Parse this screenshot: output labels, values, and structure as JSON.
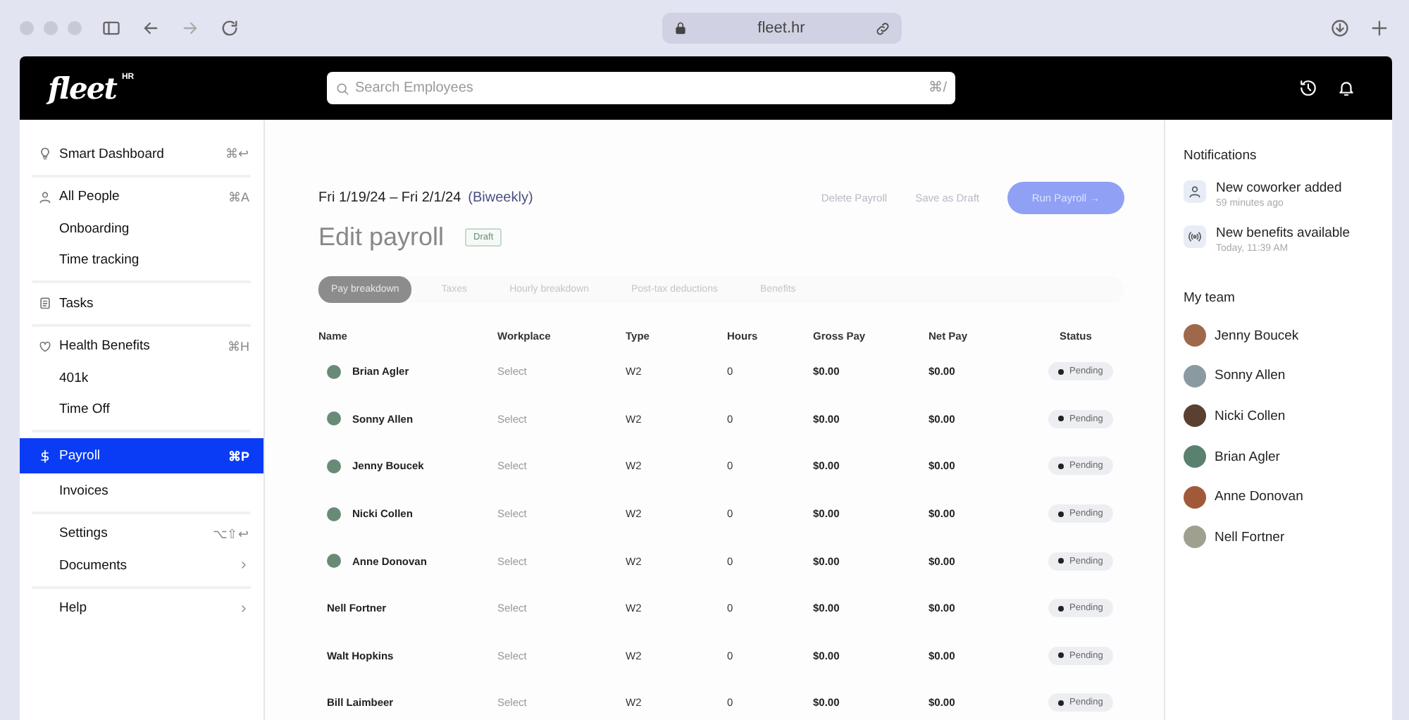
{
  "browser": {
    "address": "fleet.hr"
  },
  "header": {
    "logo": "fleet",
    "logo_badge": "HR",
    "search": {
      "placeholder": "Search Employees",
      "shortcut": "⌘/"
    }
  },
  "sidebar": {
    "groups": [
      {
        "items": [
          {
            "label": "Smart Dashboard",
            "shortcut": "⌘↩",
            "selected": false,
            "submenu": false
          }
        ]
      },
      {
        "items": [
          {
            "label": "All People",
            "shortcut": "⌘A",
            "selected": false,
            "submenu": false
          },
          {
            "label": "Onboarding",
            "selected": false,
            "submenu": false
          },
          {
            "label": "Time tracking",
            "selected": false,
            "submenu": false
          }
        ]
      },
      {
        "items": [
          {
            "label": "Tasks",
            "selected": false,
            "submenu": false
          }
        ]
      },
      {
        "items": [
          {
            "label": "Health Benefits",
            "shortcut": "⌘H",
            "selected": false,
            "submenu": false
          },
          {
            "label": "401k",
            "selected": false,
            "submenu": false
          },
          {
            "label": "Time Off",
            "selected": false,
            "submenu": false
          }
        ]
      },
      {
        "items": [
          {
            "label": "Payroll",
            "shortcut": "⌘P",
            "selected": true,
            "submenu": false
          },
          {
            "label": "Invoices",
            "selected": false,
            "submenu": false
          }
        ]
      },
      {
        "items": [
          {
            "label": "Settings",
            "shortcut": "⌥⇧↩",
            "selected": false,
            "submenu": false
          },
          {
            "label": "Documents",
            "selected": false,
            "submenu": true
          }
        ]
      },
      {
        "items": [
          {
            "label": "Help",
            "selected": false,
            "submenu": true
          }
        ]
      }
    ]
  },
  "main": {
    "period": "Fri 1/19/24 – Fri 2/1/24",
    "frequency": "(Biweekly)",
    "title": "Edit payroll",
    "badge": "Draft",
    "buttons": [
      {
        "label": "Delete Payroll",
        "kind": "text",
        "disabled": true
      },
      {
        "label": "Save as Draft",
        "kind": "text",
        "disabled": true
      },
      {
        "label": "Run Payroll →",
        "kind": "primary",
        "disabled": true
      }
    ],
    "tabs": [
      {
        "label": "Pay breakdown",
        "selected": true
      },
      {
        "label": "Taxes",
        "selected": false
      },
      {
        "label": "Hourly breakdown",
        "selected": false
      },
      {
        "label": "Post-tax deductions",
        "selected": false
      },
      {
        "label": "Benefits",
        "selected": false
      }
    ],
    "table": {
      "columns": [
        "Name",
        "Workplace",
        "Type",
        "Hours",
        "Gross Pay",
        "Net Pay",
        "Status"
      ],
      "rows": [
        {
          "name": "Brian Agler",
          "avatar": true,
          "workplace": "Select",
          "type": "W2",
          "hours": "0",
          "gross": "$0.00",
          "net": "$0.00",
          "status": "Pending"
        },
        {
          "name": "Sonny Allen",
          "avatar": true,
          "workplace": "Select",
          "type": "W2",
          "hours": "0",
          "gross": "$0.00",
          "net": "$0.00",
          "status": "Pending"
        },
        {
          "name": "Jenny Boucek",
          "avatar": true,
          "workplace": "Select",
          "type": "W2",
          "hours": "0",
          "gross": "$0.00",
          "net": "$0.00",
          "status": "Pending"
        },
        {
          "name": "Nicki Collen",
          "avatar": true,
          "workplace": "Select",
          "type": "W2",
          "hours": "0",
          "gross": "$0.00",
          "net": "$0.00",
          "status": "Pending"
        },
        {
          "name": "Anne Donovan",
          "avatar": true,
          "workplace": "Select",
          "type": "W2",
          "hours": "0",
          "gross": "$0.00",
          "net": "$0.00",
          "status": "Pending"
        },
        {
          "name": "Nell Fortner",
          "avatar": false,
          "workplace": "Select",
          "type": "W2",
          "hours": "0",
          "gross": "$0.00",
          "net": "$0.00",
          "status": "Pending"
        },
        {
          "name": "Walt Hopkins",
          "avatar": false,
          "workplace": "Select",
          "type": "W2",
          "hours": "0",
          "gross": "$0.00",
          "net": "$0.00",
          "status": "Pending"
        },
        {
          "name": "Bill Laimbeer",
          "avatar": false,
          "workplace": "Select",
          "type": "W2",
          "hours": "0",
          "gross": "$0.00",
          "net": "$0.00",
          "status": "Pending"
        }
      ]
    }
  },
  "right_panel": {
    "notifications_title": "Notifications",
    "notifications": [
      {
        "kind": "person",
        "title": "New coworker added",
        "time": "59 minutes ago"
      },
      {
        "kind": "broadcast",
        "title": "New benefits available",
        "time": "Today, 11:39 AM"
      }
    ],
    "team_title": "My team",
    "team": [
      {
        "name": "Jenny Boucek",
        "color": "#a0684a"
      },
      {
        "name": "Sonny Allen",
        "color": "#8a9aa0"
      },
      {
        "name": "Nicki Collen",
        "color": "#5a4030"
      },
      {
        "name": "Brian Agler",
        "color": "#5a8070"
      },
      {
        "name": "Anne Donovan",
        "color": "#a05a3a"
      },
      {
        "name": "Nell Fortner",
        "color": "#a0a090"
      }
    ]
  }
}
